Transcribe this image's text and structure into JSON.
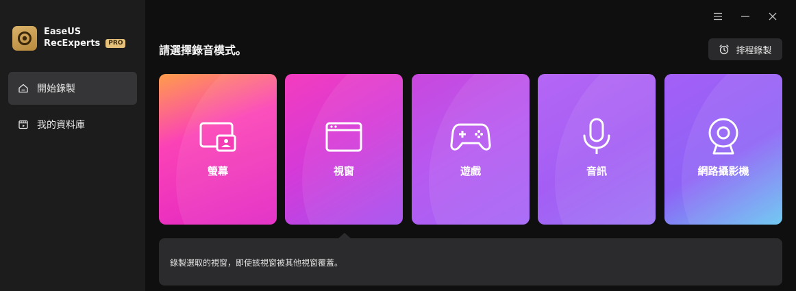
{
  "brand": {
    "line1": "EaseUS",
    "line2": "RecExperts",
    "badge": "PRO"
  },
  "sidebar": {
    "items": [
      {
        "label": "開始錄製",
        "icon": "home-icon",
        "active": true
      },
      {
        "label": "我的資料庫",
        "icon": "library-icon",
        "active": false
      }
    ]
  },
  "window_controls": {
    "menu": "menu-icon",
    "minimize": "minimize-icon",
    "close": "close-icon"
  },
  "header": {
    "title": "請選擇錄音模式。",
    "schedule_label": "排程錄製"
  },
  "modes": [
    {
      "label": "螢幕",
      "icon": "screen-icon"
    },
    {
      "label": "視窗",
      "icon": "window-icon"
    },
    {
      "label": "遊戲",
      "icon": "gamepad-icon"
    },
    {
      "label": "音訊",
      "icon": "microphone-icon"
    },
    {
      "label": "網路攝影機",
      "icon": "webcam-icon"
    }
  ],
  "tooltip": {
    "text": "錄製選取的視窗，即使該視窗被其他視窗覆蓋。",
    "pointer_target": "視窗"
  },
  "colors": {
    "background": "#0f0f10",
    "sidebar": "#1c1c1d",
    "accent": "#e5c07b"
  }
}
